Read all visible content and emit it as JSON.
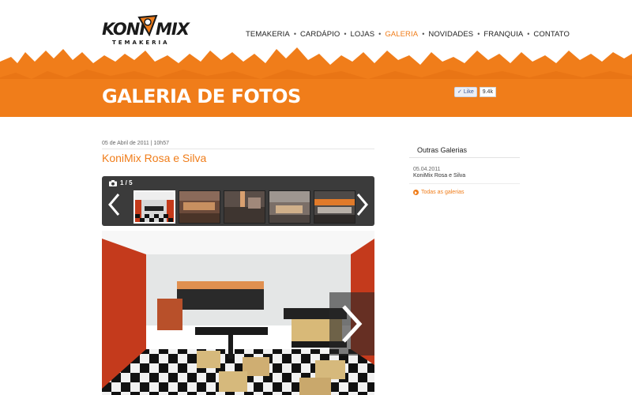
{
  "brand": {
    "logo_text_left": "KONI",
    "logo_text_right": "MIX",
    "logo_sub": "TEMAKERIA",
    "accent_color": "#f07d1a"
  },
  "nav": {
    "items": [
      {
        "label": "TEMAKERIA",
        "active": false
      },
      {
        "label": "CARDÁPIO",
        "active": false
      },
      {
        "label": "LOJAS",
        "active": false
      },
      {
        "label": "GALERIA",
        "active": true
      },
      {
        "label": "NOVIDADES",
        "active": false
      },
      {
        "label": "FRANQUIA",
        "active": false
      },
      {
        "label": "CONTATO",
        "active": false
      }
    ],
    "separator": "•"
  },
  "banner": {
    "title": "GALERIA DE FOTOS",
    "fb_like_label": "Like",
    "fb_like_count": "9.4k"
  },
  "article": {
    "date": "05 de Abril de 2011 | 10h57",
    "title": "KoniMix Rosa e Silva"
  },
  "gallery": {
    "counter": "1 / 5",
    "camera_icon": "camera-icon",
    "prev_icon": "chevron-left-icon",
    "next_icon": "chevron-right-icon",
    "thumb_count": 5,
    "selected_thumb": 1
  },
  "sidebar": {
    "title": "Outras Galerias",
    "entries": [
      {
        "date": "05.04.2011",
        "label": "KoniMix Rosa e Silva"
      }
    ],
    "all_link": "Todas as galerias"
  }
}
